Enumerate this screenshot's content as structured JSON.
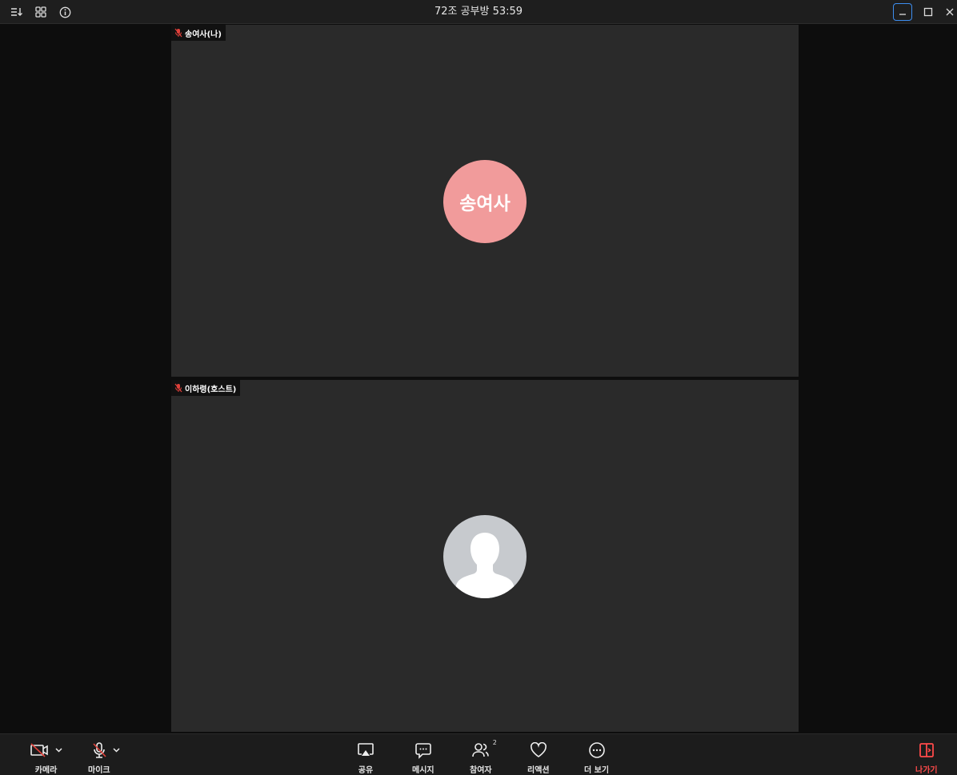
{
  "window": {
    "title": "72조 공부방 53:59"
  },
  "participants": [
    {
      "label": "송여사(나)",
      "avatar_text": "송여사",
      "avatar_color": "#f19b9b",
      "muted": true
    },
    {
      "label": "이하령(호스트)",
      "avatar_text": "",
      "avatar_color": "#c7cace",
      "muted": true
    }
  ],
  "toolbar": {
    "camera_label": "카메라",
    "mic_label": "마이크",
    "share_label": "공유",
    "message_label": "메시지",
    "participants_label": "참여자",
    "participants_count": "2",
    "reaction_label": "리액션",
    "more_label": "더 보기",
    "leave_label": "나가기"
  },
  "colors": {
    "accent": "#3d8ef0",
    "leave": "#ff4a4a",
    "muted_icon": "#e0403a"
  },
  "icons": {
    "titlebar": [
      "sort-icon",
      "grid-icon",
      "info-icon"
    ],
    "toolbar": [
      "camera-off-icon",
      "mic-off-icon",
      "share-screen-icon",
      "chat-icon",
      "participants-icon",
      "heart-icon",
      "more-icon",
      "leave-icon"
    ]
  }
}
